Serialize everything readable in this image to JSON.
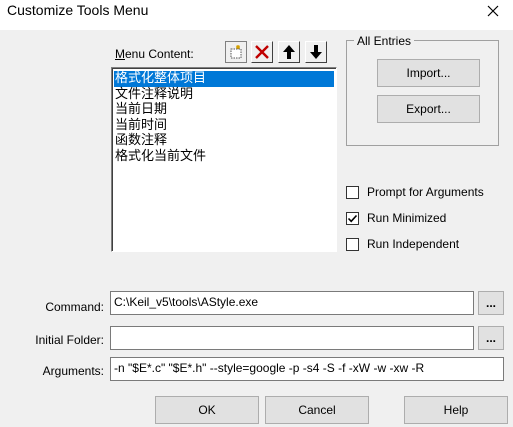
{
  "window": {
    "title": "Customize Tools Menu",
    "close_glyph": "✕"
  },
  "menu_content": {
    "label": "Menu Content:",
    "toolbar": [
      "new-entry-icon",
      "delete-icon",
      "move-up-icon",
      "move-down-icon"
    ],
    "items": [
      "格式化整体项目",
      "文件注释说明",
      "当前日期",
      "当前时间",
      "函数注释",
      "格式化当前文件"
    ],
    "selected_index": 0
  },
  "all_entries": {
    "title": "All Entries",
    "import_label": "Import...",
    "export_label": "Export..."
  },
  "options": {
    "prompt_label": "Prompt for  Arguments",
    "prompt_checked": false,
    "minimized_label": "Run Minimized",
    "minimized_checked": true,
    "independent_label": "Run Independent",
    "independent_checked": false
  },
  "fields": {
    "command_label": "Command:",
    "command_value": "C:\\Keil_v5\\tools\\AStyle.exe",
    "folder_label": "Initial Folder:",
    "folder_value": "",
    "arguments_label": "Arguments:",
    "arguments_value": "-n \"$E*.c\" \"$E*.h\" --style=google -p -s4 -S -f -xW -w -xw -R",
    "browse_label": "..."
  },
  "buttons": {
    "ok": "OK",
    "cancel": "Cancel",
    "help": "Help"
  },
  "colors": {
    "selection": "#0078d7",
    "delete_icon": "#c00000"
  }
}
